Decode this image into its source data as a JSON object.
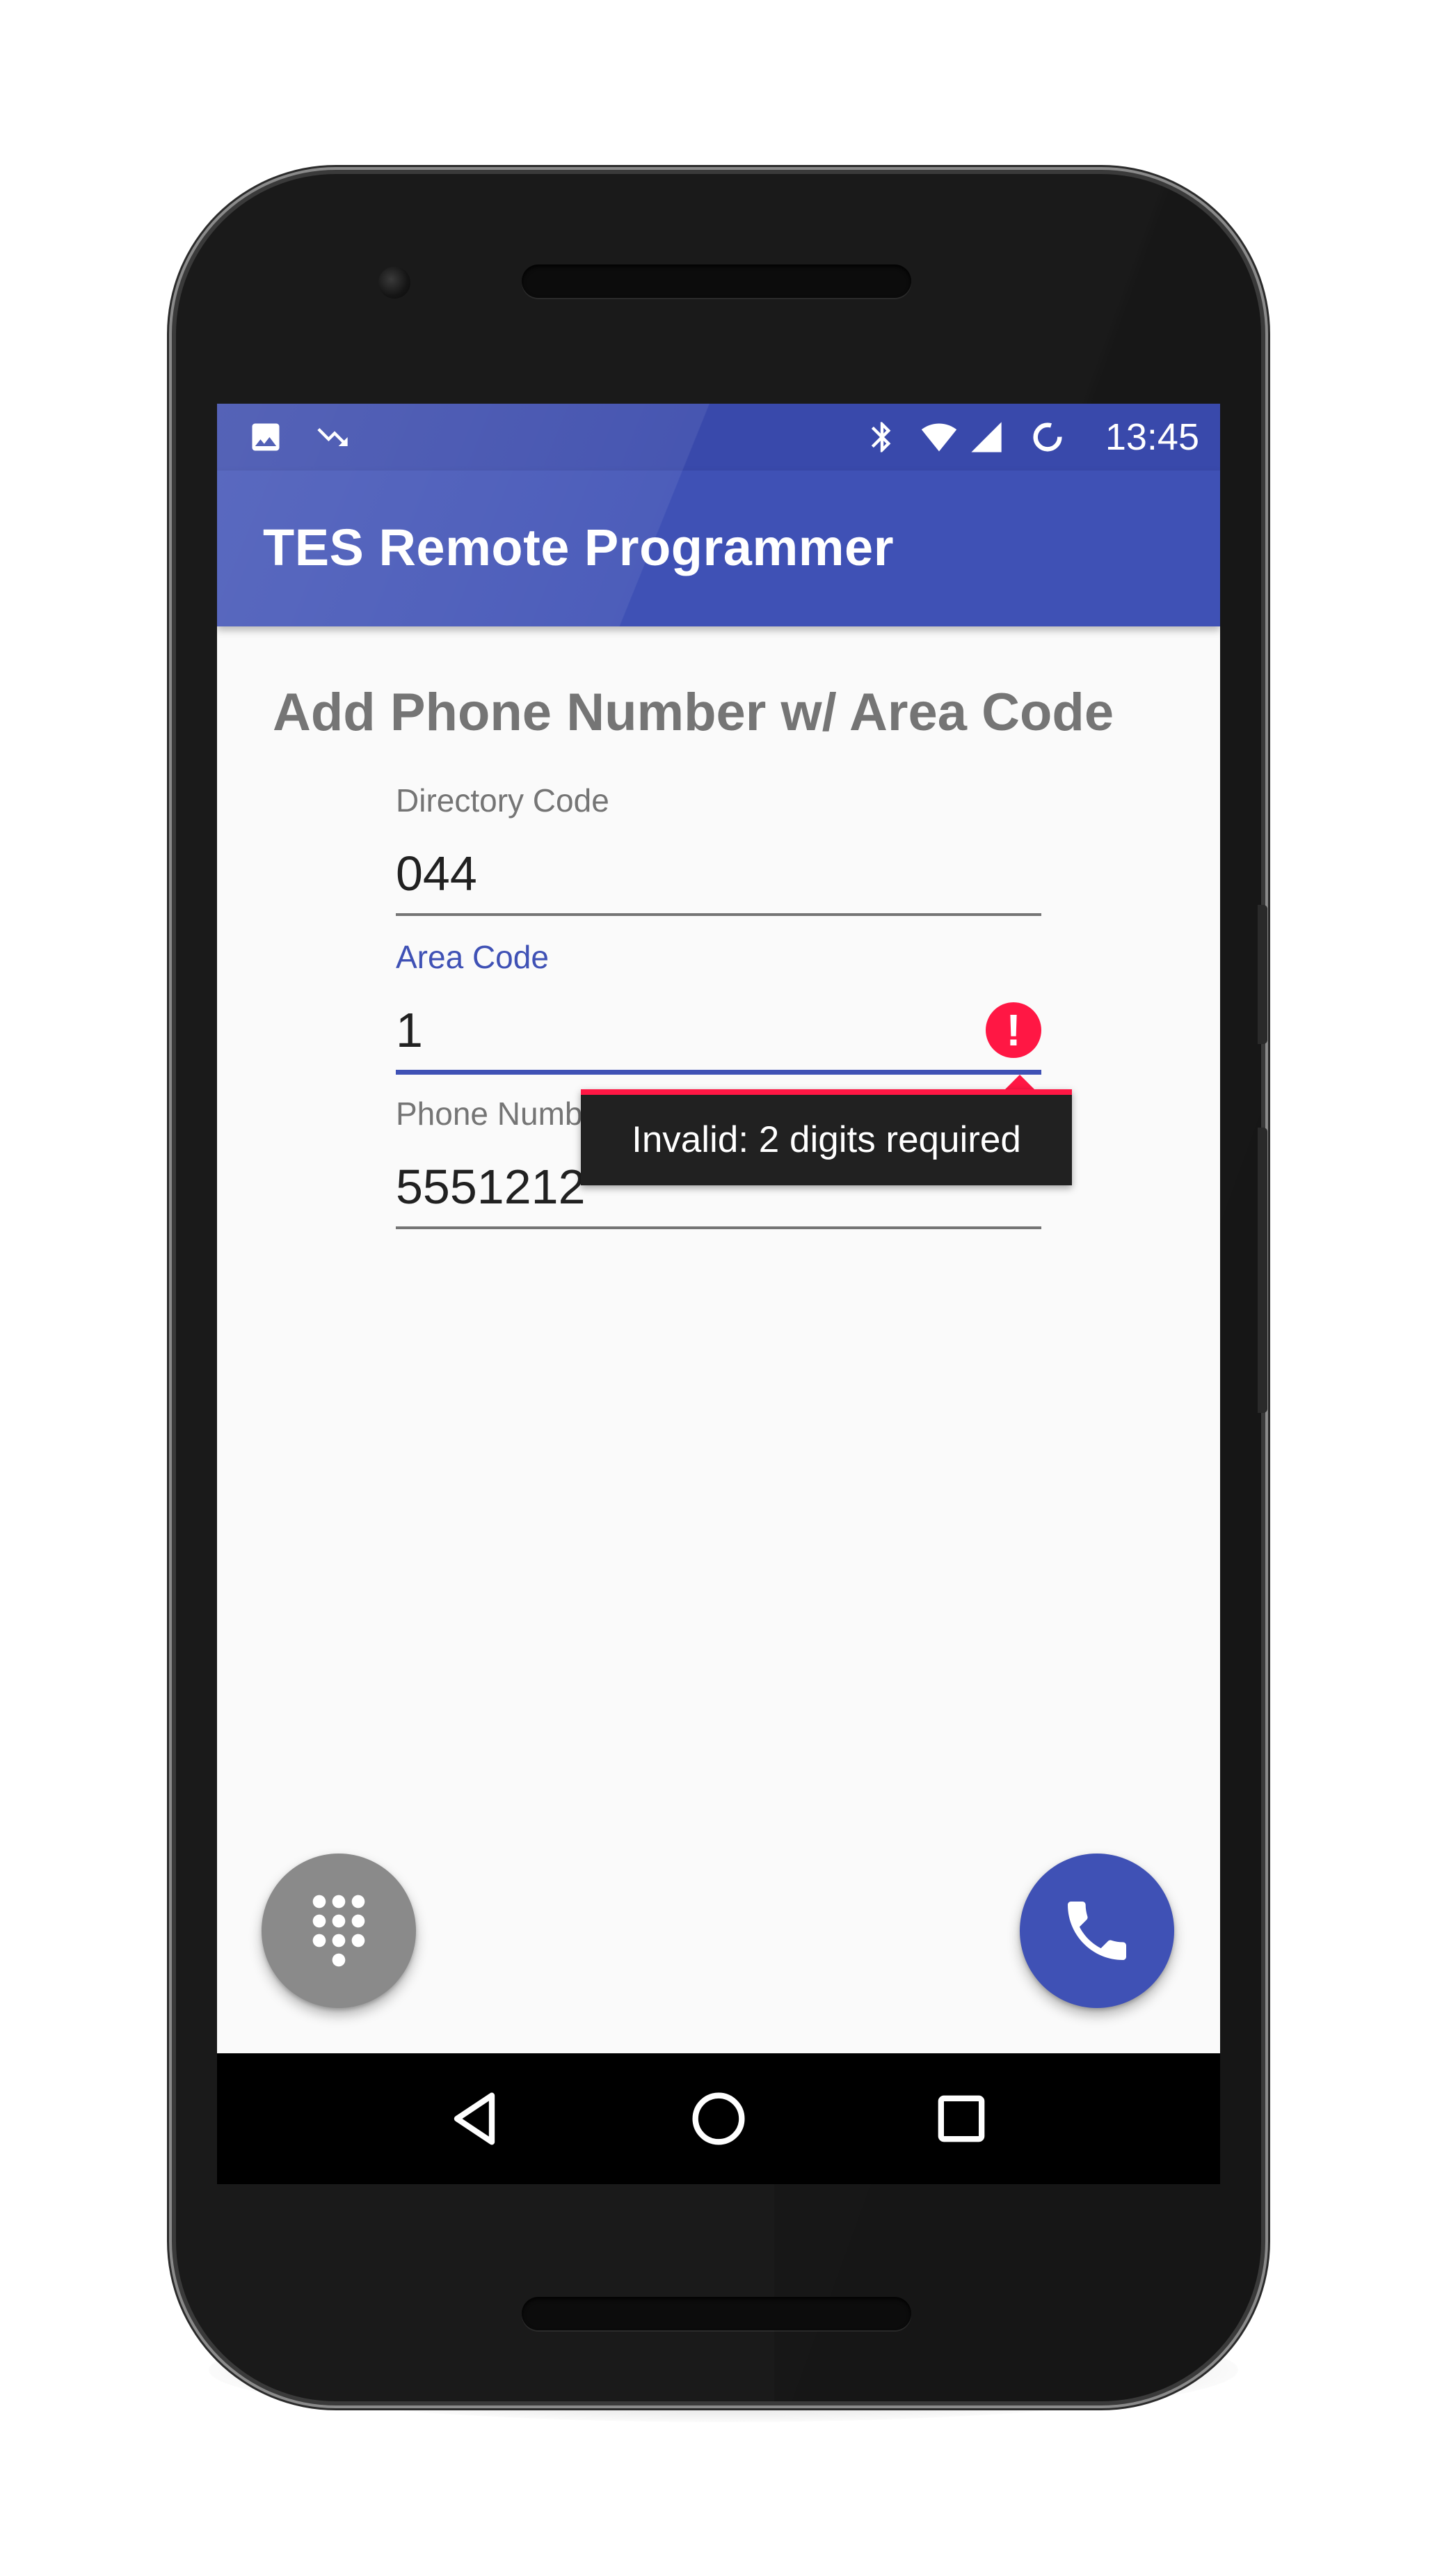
{
  "status_bar": {
    "time": "13:45",
    "left_icons": [
      "image-icon",
      "trending-down-icon"
    ],
    "right_icons": [
      "bluetooth-icon",
      "wifi-icon",
      "cell-signal-icon",
      "sync-icon"
    ]
  },
  "app_bar": {
    "title": "TES Remote Programmer"
  },
  "form": {
    "heading": "Add Phone Number w/ Area Code",
    "directory_code": {
      "label": "Directory Code",
      "value": "044"
    },
    "area_code": {
      "label": "Area Code",
      "value": "1",
      "error": "Invalid: 2 digits required"
    },
    "phone_number": {
      "label": "Phone Number",
      "value": "5551212"
    }
  },
  "fabs": {
    "dialpad_icon": "dialpad-icon",
    "call_icon": "phone-icon"
  },
  "nav_bar": {
    "items": [
      "back-icon",
      "home-icon",
      "recents-icon"
    ]
  },
  "colors": {
    "primary": "#3f51b5",
    "primary_dark": "#3949ab",
    "error": "#ff1744",
    "fab_gray": "#8a8a8a"
  }
}
